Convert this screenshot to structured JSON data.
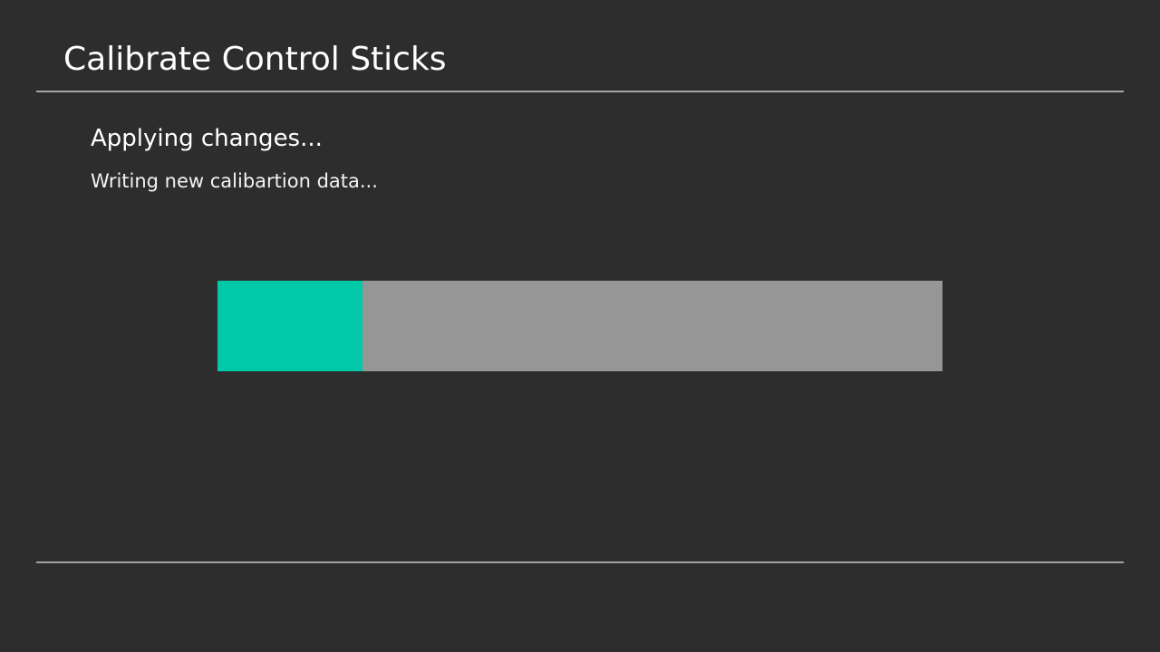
{
  "header": {
    "title": "Calibrate Control Sticks"
  },
  "status": {
    "heading": "Applying changes...",
    "detail": "Writing new calibartion data..."
  },
  "progress": {
    "fraction": 0.2,
    "fill_color": "#00c8a8",
    "track_color": "#969696"
  },
  "theme": {
    "background": "#2d2d2d",
    "divider": "#a3a3a3",
    "text": "#ffffff"
  }
}
